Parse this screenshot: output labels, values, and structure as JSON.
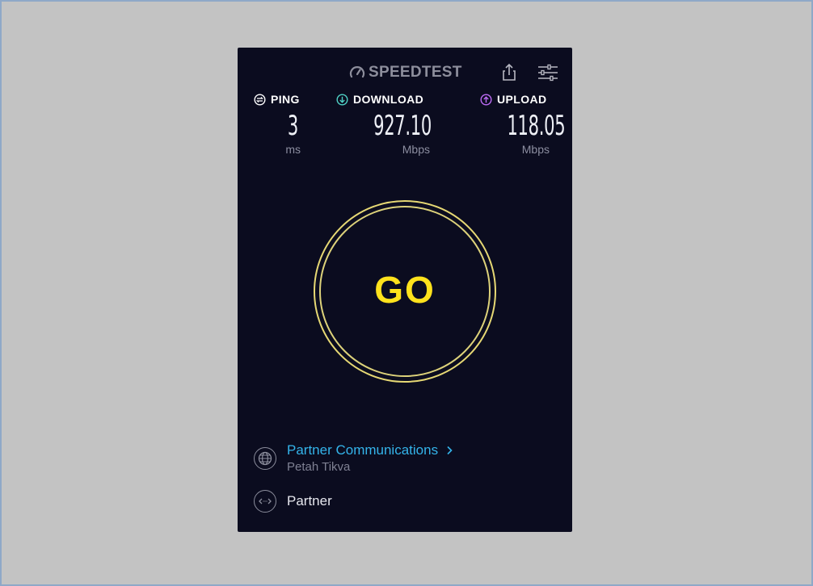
{
  "app": {
    "brand": "SPEEDTEST",
    "icons": {
      "gauge": "gauge-icon",
      "share": "share-icon",
      "settings": "sliders-icon"
    }
  },
  "metrics": {
    "ping": {
      "label": "PING",
      "value": "3",
      "unit": "ms",
      "icon": "ping-icon",
      "color": "#ffffff"
    },
    "download": {
      "label": "DOWNLOAD",
      "value": "927.10",
      "unit": "Mbps",
      "icon": "download-arrow-icon",
      "color": "#4fd1c5"
    },
    "upload": {
      "label": "UPLOAD",
      "value": "118.05",
      "unit": "Mbps",
      "icon": "upload-arrow-icon",
      "color": "#bd6cf5"
    }
  },
  "go_button": {
    "label": "GO",
    "color": "#ffe21c",
    "ring_color": "#e6d874"
  },
  "server": {
    "isp_name": "Partner Communications",
    "isp_location": "Petah Tikva",
    "host_name": "Partner",
    "isp_icon": "globe-icon",
    "host_icon": "server-connection-icon",
    "link_color": "#34b4ea"
  },
  "colors": {
    "background": "#0b0c1f",
    "page": "#c3c3c3"
  }
}
